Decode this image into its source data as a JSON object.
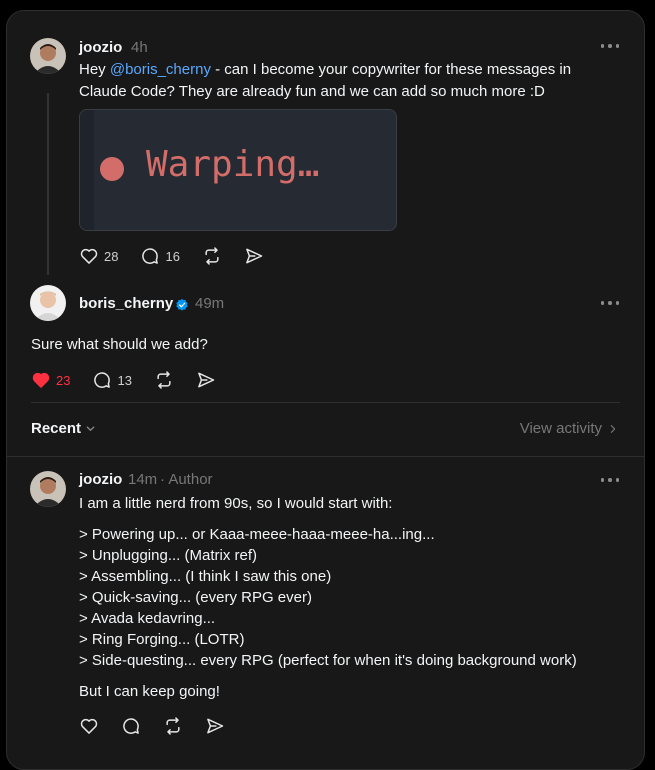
{
  "post1": {
    "username": "joozio",
    "time": "4h",
    "text_before_mention": "Hey ",
    "mention": "@boris_cherny",
    "text_after_mention": " - can I become your copywriter for these messages in",
    "text_line2": "Claude Code? They are already fun and we can add so much more :D",
    "image_text": "Warping…",
    "likes": "28",
    "replies": "16"
  },
  "post2": {
    "username": "boris_cherny",
    "time": "49m",
    "text": "Sure what should we add?",
    "likes": "23",
    "replies": "13"
  },
  "activity_bar": {
    "recent_label": "Recent",
    "view_activity_label": "View activity"
  },
  "post3": {
    "username": "joozio",
    "time": "14m",
    "author_tag": "· Author",
    "intro": "I am a little nerd from 90s, so I would start with:",
    "lines": [
      "> Powering up... or Kaaa-meee-haaa-meee-ha...ing...",
      "> Unplugging... (Matrix ref)",
      "> Assembling... (I think I saw this one)",
      "> Quick-saving... (every RPG ever)",
      "> Avada kedavring...",
      "> Ring Forging... (LOTR)",
      "> Side-questing... every RPG (perfect for when it's doing background work)"
    ],
    "outro": "But I can keep going!"
  },
  "colors": {
    "background": "#181818",
    "text": "#f3f5f7",
    "muted": "#777777",
    "mention": "#5aa8ff",
    "like_active": "#ff3040",
    "verified": "#0095f6",
    "warp_red": "#d36d6a"
  },
  "icons": [
    "heart-icon",
    "comment-icon",
    "repost-icon",
    "share-icon",
    "more-icon",
    "verified-icon",
    "chevron-down-icon",
    "chevron-right-icon"
  ]
}
